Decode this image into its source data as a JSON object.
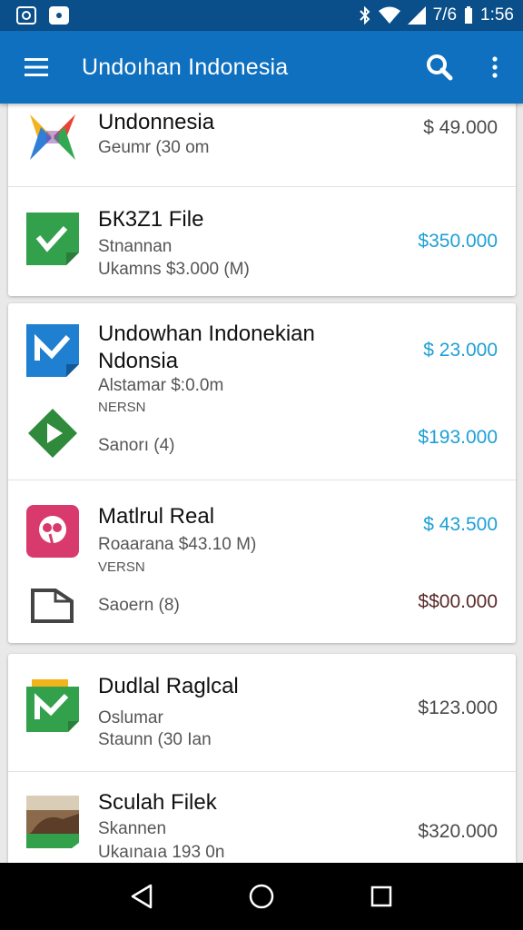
{
  "status_bar": {
    "time": "1:56",
    "battery_text": "7/6"
  },
  "app_bar": {
    "title": "Undoıhan Indonesia"
  },
  "colors": {
    "app_bar": "#0e70bf",
    "status_bar": "#0a4f8a",
    "price_blue": "#1e9fd6"
  },
  "cards": [
    {
      "items": [
        {
          "title": "Undonnesia",
          "line1": "Geumr (30 om",
          "price": "$ 49.000",
          "icon": "multicolor-x-icon"
        },
        {
          "title": "БК3Z1 File",
          "line1": "Stnannan",
          "line2": "Ukamns $3.000 (M)",
          "price": "$350.000",
          "icon": "green-check-doc-icon"
        }
      ]
    },
    {
      "items": [
        {
          "title": "Undowhan Indonekian",
          "title2": "Ndonsia",
          "line1": "Alstamar $:0.0m",
          "small": "NERSN",
          "price": "$ 23.000",
          "icon": "blue-check-doc-icon"
        },
        {
          "line1": "Sanorı (4)",
          "price": "$193.000",
          "icon": "green-play-icon"
        },
        {
          "title": "Matlrul Real",
          "line1": "Roaarana $43.10 M)",
          "small": "VERSN",
          "price": "$ 43.500",
          "icon": "pink-flower-icon"
        },
        {
          "line1": "Saoern (8)",
          "price": "$$00.000",
          "icon": "folder-icon"
        }
      ]
    },
    {
      "items": [
        {
          "title": "Dudlal Raglcal",
          "line1": "Oslumar",
          "line2": "Staunn (30 Ian",
          "price": "$123.000",
          "icon": "green-check-folder-icon"
        },
        {
          "title": "Sculah Filek",
          "line1": "Skannen",
          "line2": "Ukaınaıa 193 0n",
          "price": "$320.000",
          "icon": "photo-thumbnail-icon"
        }
      ]
    }
  ]
}
